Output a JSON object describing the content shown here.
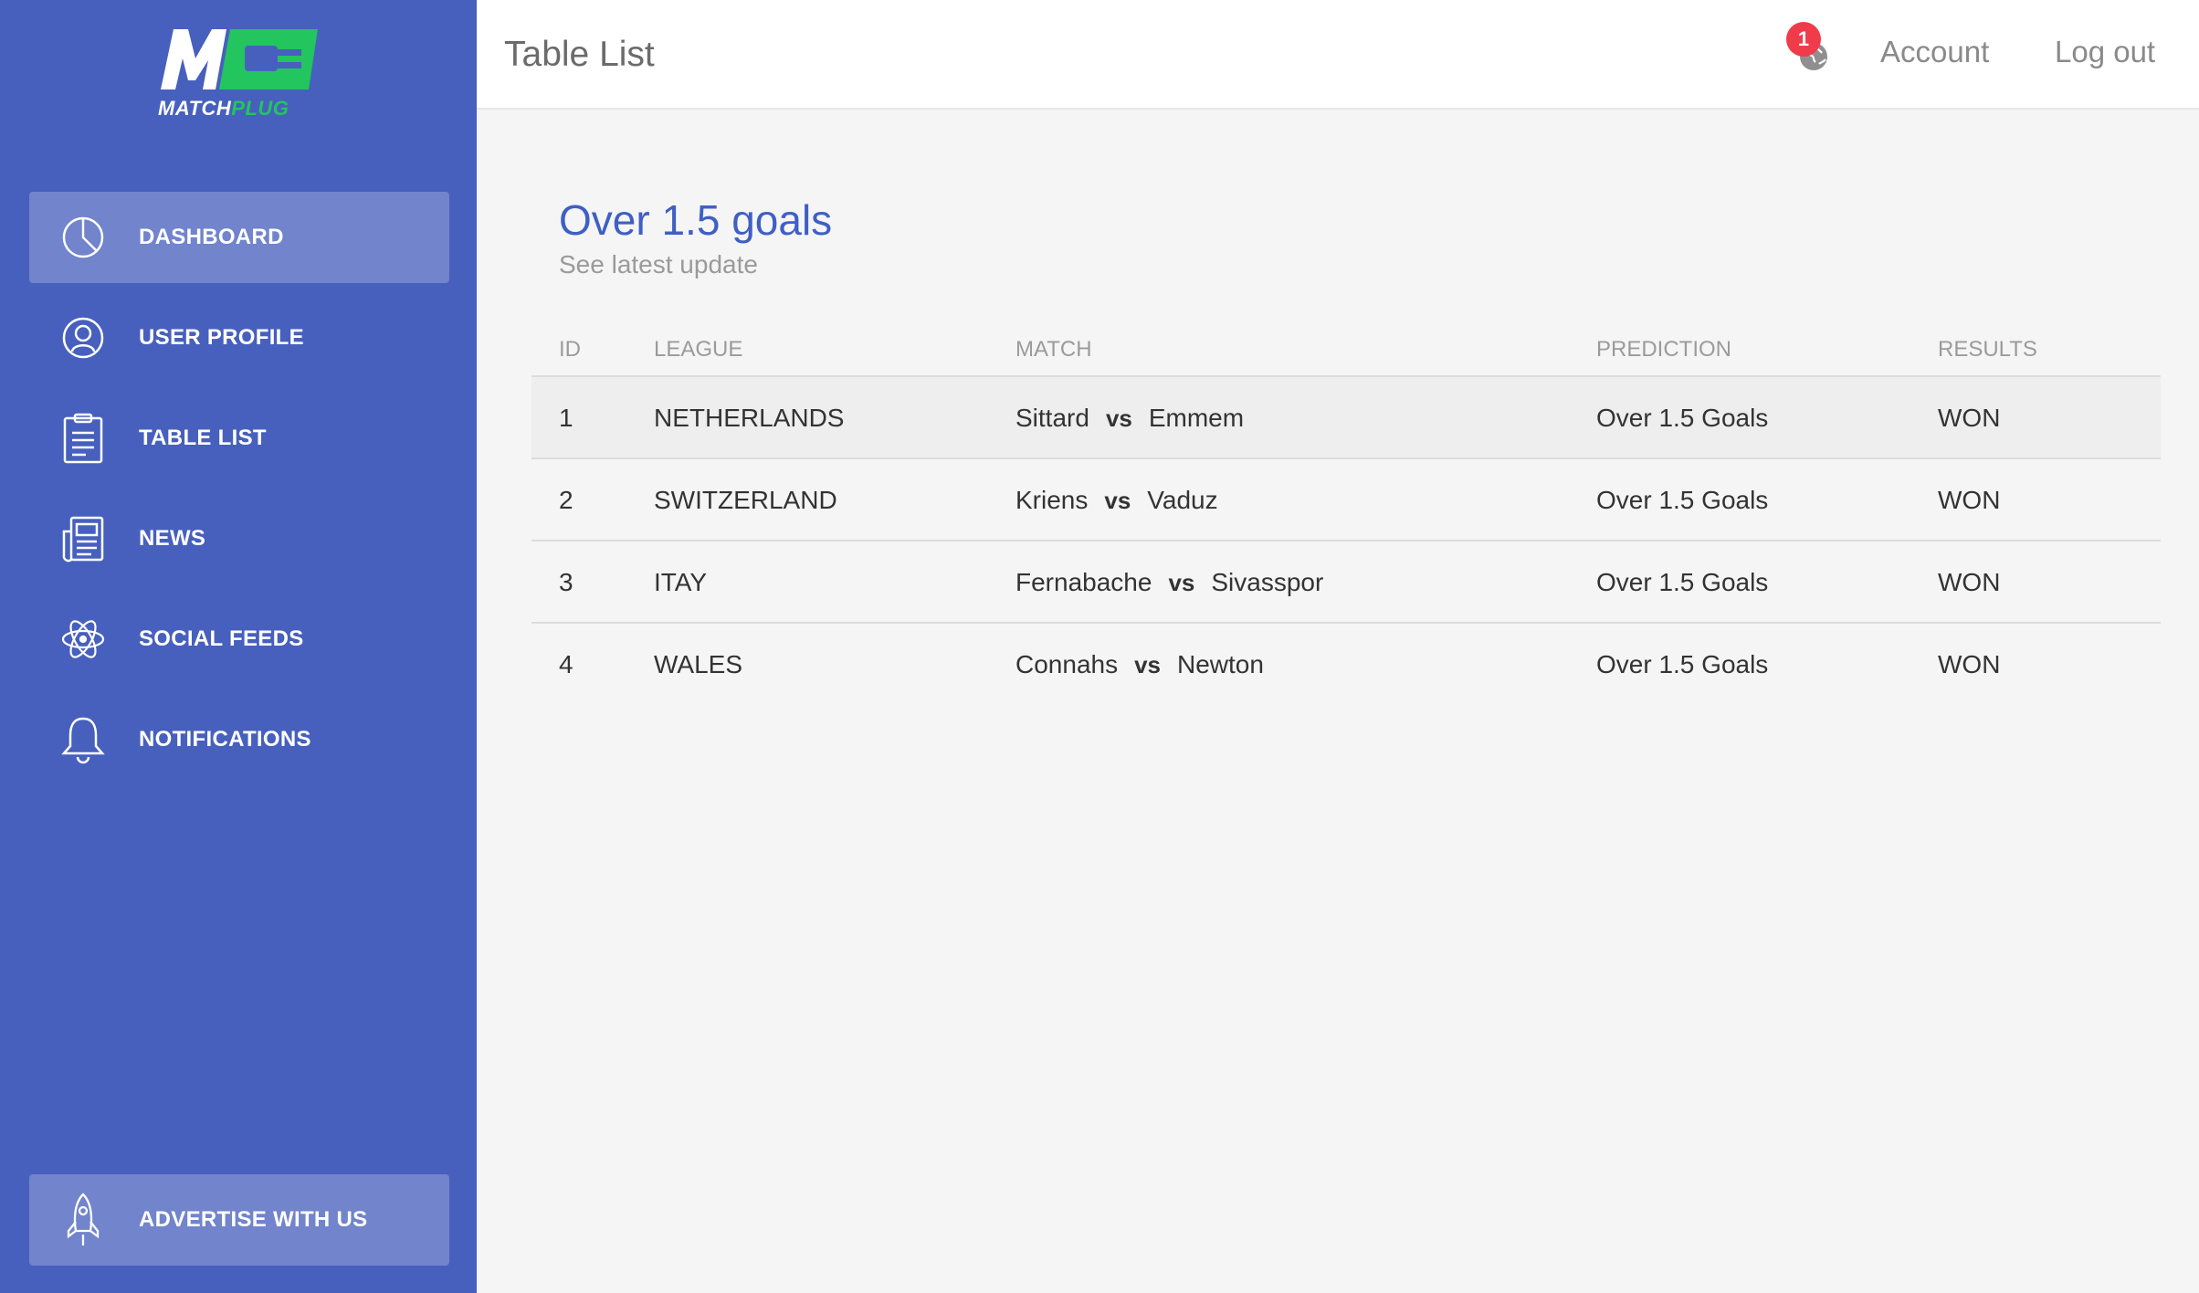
{
  "brand": {
    "logo_part1": "MATCH",
    "logo_part2": "PLUG",
    "colors": {
      "sidebar": "#4760bd",
      "accent": "#22c55e",
      "title_blue": "#3f5fc4",
      "badge": "#ef3b4a"
    }
  },
  "sidebar": {
    "items": [
      {
        "label": "DASHBOARD",
        "icon": "pie-chart-icon"
      },
      {
        "label": "USER PROFILE",
        "icon": "user-icon"
      },
      {
        "label": "TABLE LIST",
        "icon": "clipboard-icon"
      },
      {
        "label": "NEWS",
        "icon": "newspaper-icon"
      },
      {
        "label": "SOCIAL FEEDS",
        "icon": "atom-icon"
      },
      {
        "label": "NOTIFICATIONS",
        "icon": "bell-icon"
      }
    ],
    "bottom_item": {
      "label": "ADVERTISE WITH US",
      "icon": "rocket-icon"
    }
  },
  "header": {
    "title": "Table List",
    "notification_count": "1",
    "account_label": "Account",
    "logout_label": "Log out"
  },
  "card": {
    "title": "Over 1.5 goals",
    "subtitle": "See latest update"
  },
  "table": {
    "headers": {
      "id": "ID",
      "league": "LEAGUE",
      "match": "MATCH",
      "prediction": "PREDICTION",
      "results": "RESULTS"
    },
    "vs_label": "vs",
    "rows": [
      {
        "id": "1",
        "league": "NETHERLANDS",
        "home": "Sittard",
        "away": "Emmem",
        "prediction": "Over 1.5 Goals",
        "result": "WON"
      },
      {
        "id": "2",
        "league": "SWITZERLAND",
        "home": "Kriens",
        "away": "Vaduz",
        "prediction": "Over 1.5 Goals",
        "result": "WON"
      },
      {
        "id": "3",
        "league": "ITAY",
        "home": "Fernabache",
        "away": "Sivasspor",
        "prediction": "Over 1.5 Goals",
        "result": "WON"
      },
      {
        "id": "4",
        "league": "WALES",
        "home": "Connahs",
        "away": "Newton",
        "prediction": "Over 1.5 Goals",
        "result": "WON"
      }
    ]
  }
}
